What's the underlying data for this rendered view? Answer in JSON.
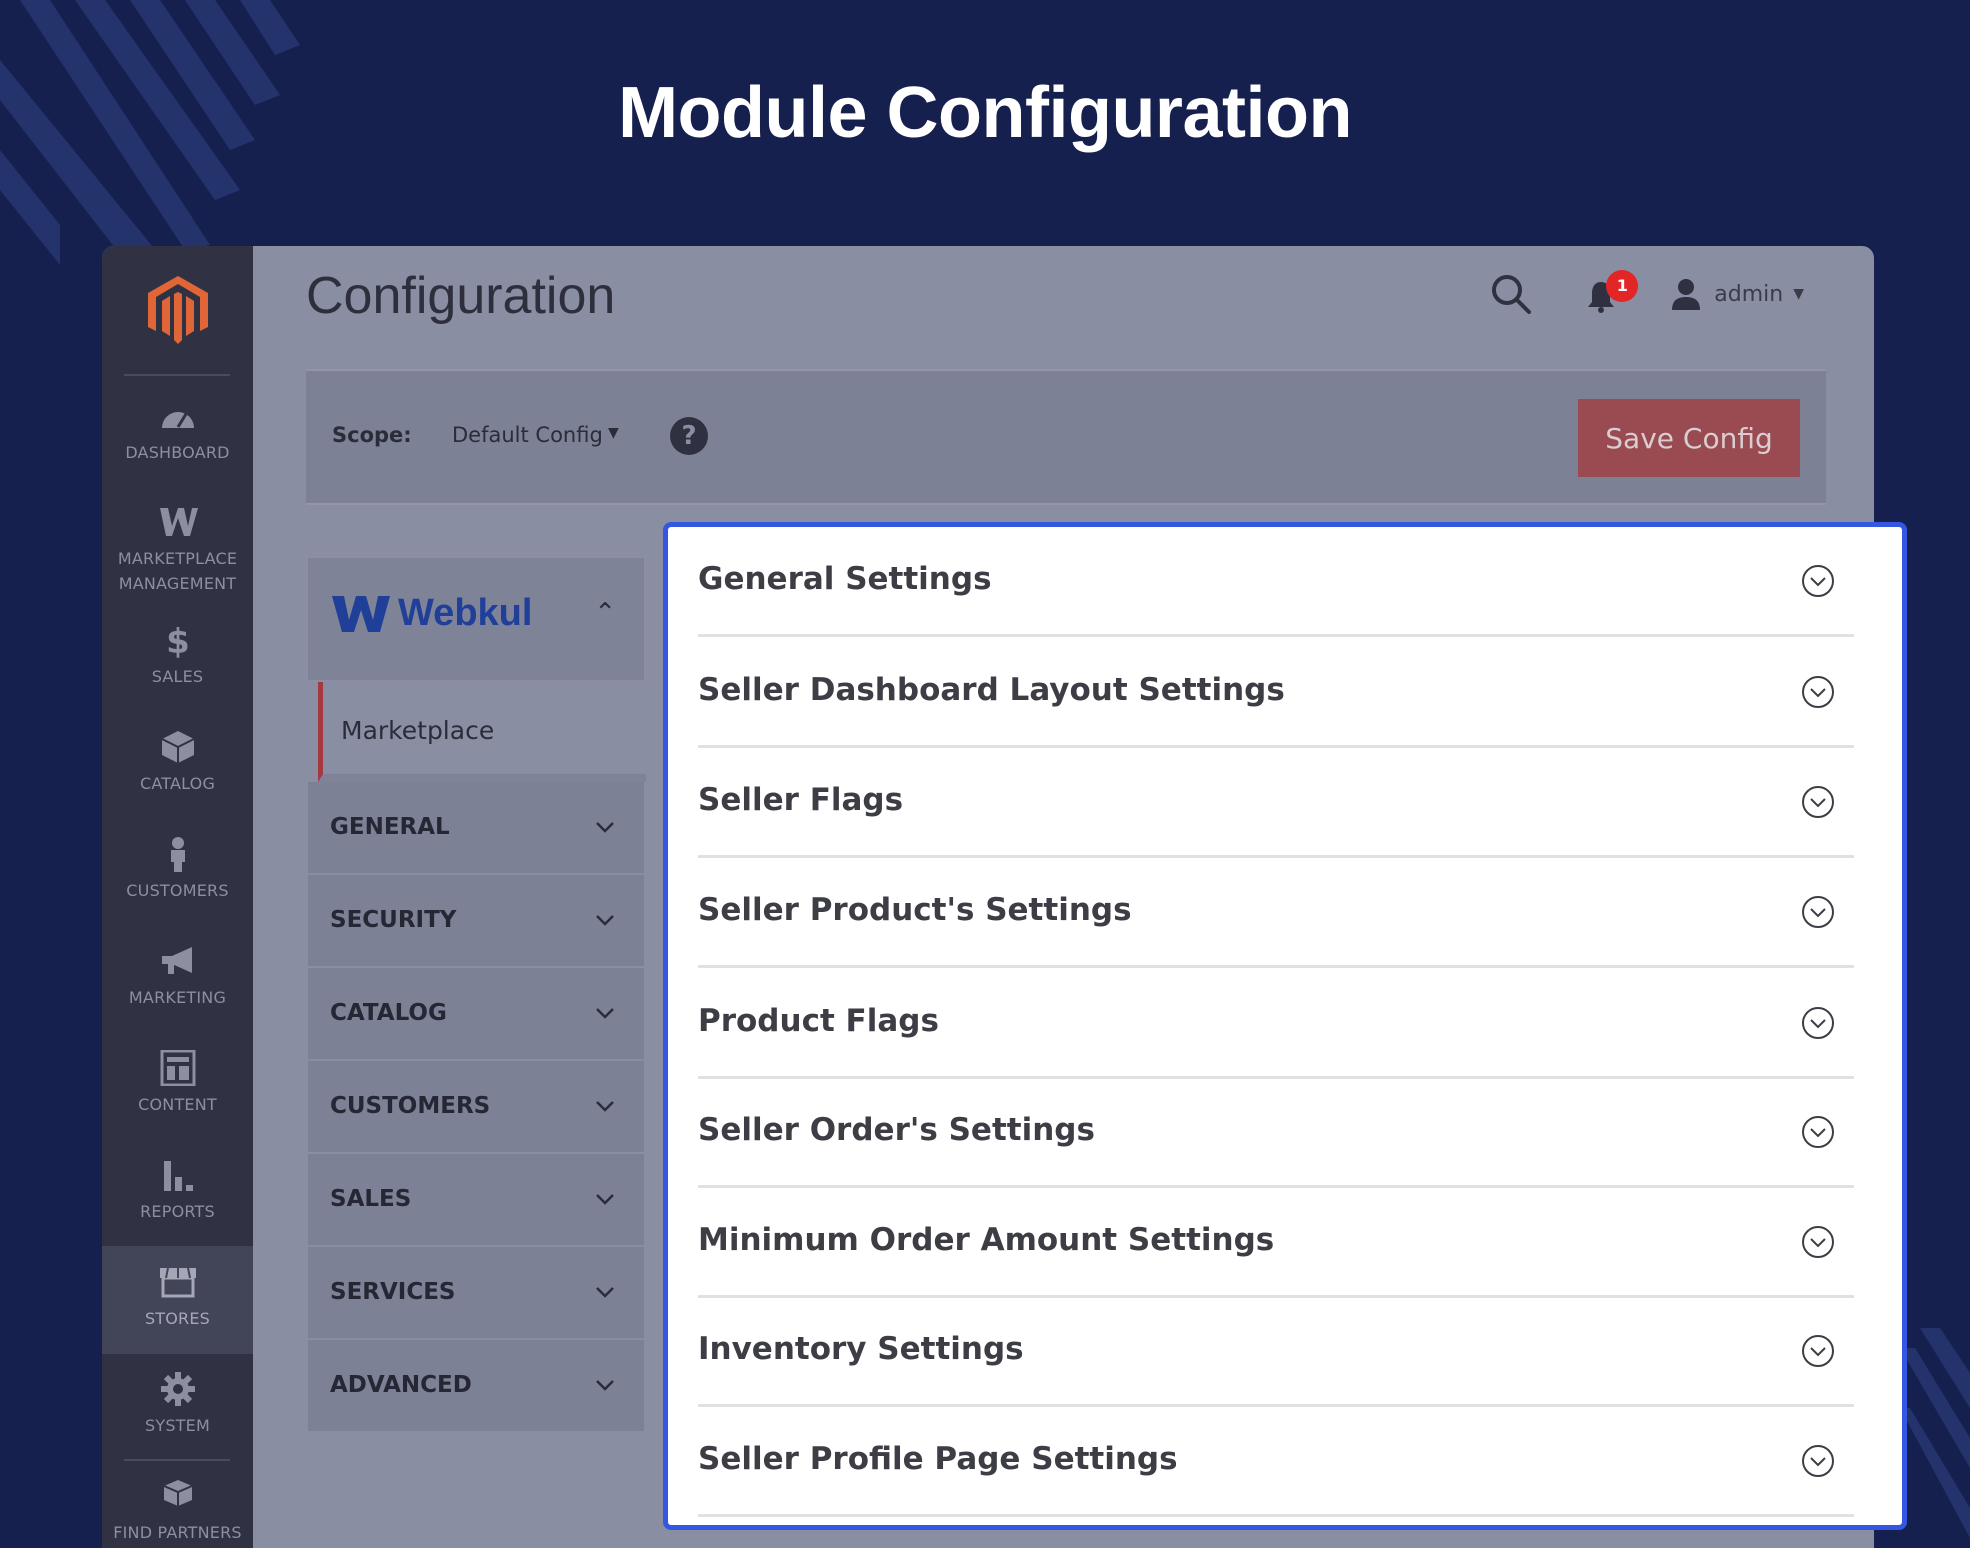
{
  "headline": "Module Configuration",
  "colors": {
    "accent_border": "#3457e3",
    "save_button": "#9a4b51",
    "brand_orange": "#e06638",
    "webkul_blue": "#1f3f98"
  },
  "sidebar": {
    "items": [
      {
        "label": "DASHBOARD",
        "icon": "dashboard-gauge-icon"
      },
      {
        "label": "MARKETPLACE MANAGEMENT",
        "icon": "webkul-w-icon"
      },
      {
        "label": "SALES",
        "icon": "dollar-icon"
      },
      {
        "label": "CATALOG",
        "icon": "box-icon"
      },
      {
        "label": "CUSTOMERS",
        "icon": "person-icon"
      },
      {
        "label": "MARKETING",
        "icon": "megaphone-icon"
      },
      {
        "label": "CONTENT",
        "icon": "layout-icon"
      },
      {
        "label": "REPORTS",
        "icon": "bar-chart-icon"
      },
      {
        "label": "STORES",
        "icon": "store-icon",
        "active": true
      },
      {
        "label": "SYSTEM",
        "icon": "gear-icon"
      },
      {
        "label": "FIND PARTNERS",
        "icon": "boxes-icon"
      }
    ]
  },
  "header": {
    "title": "Configuration",
    "notification_count": "1",
    "user": "admin"
  },
  "scope": {
    "label": "Scope:",
    "value": "Default Config",
    "save_label": "Save Config"
  },
  "config_nav": {
    "brand": "Webkul",
    "active_item": "Marketplace",
    "sections": [
      "GENERAL",
      "SECURITY",
      "CATALOG",
      "CUSTOMERS",
      "SALES",
      "SERVICES",
      "ADVANCED"
    ]
  },
  "panel": {
    "rows": [
      "General Settings",
      "Seller Dashboard Layout Settings",
      "Seller Flags",
      "Seller Product's Settings",
      "Product Flags",
      "Seller Order's Settings",
      "Minimum Order Amount Settings",
      "Inventory Settings",
      "Seller Profile Page Settings"
    ]
  }
}
